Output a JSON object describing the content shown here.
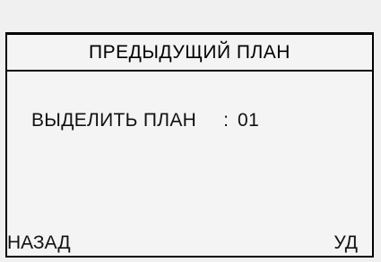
{
  "screen": {
    "title": "ПРЕДЫДУЩИЙ ПЛАН"
  },
  "field": {
    "label": "ВЫДЕЛИТЬ ПЛАН",
    "separator": ":",
    "value": "01"
  },
  "softkeys": {
    "back_label": "НАЗАД",
    "delete_label": "УД"
  }
}
